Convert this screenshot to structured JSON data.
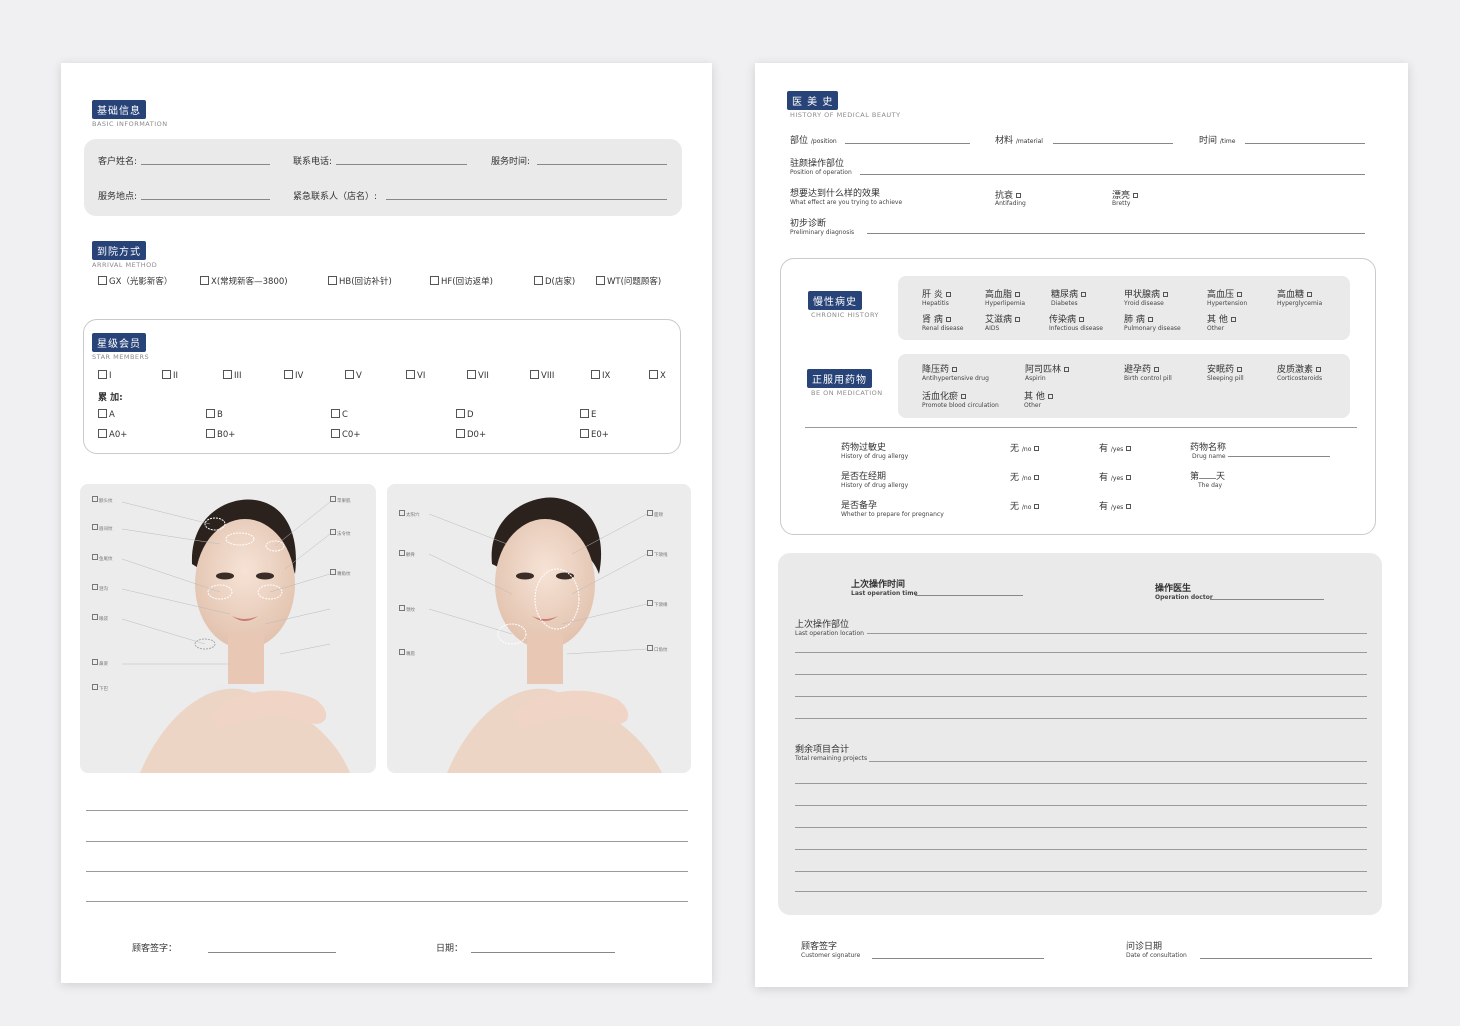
{
  "left": {
    "basic": {
      "title": "基础信息",
      "en": "BASIC INFORMATION",
      "customer_name": "客户姓名:",
      "phone": "联系电话:",
      "service_time": "服务时间:",
      "service_place": "服务地点:",
      "emergency": "紧急联系人（店名）:"
    },
    "arrival": {
      "title": "到院方式",
      "en": "ARRIVAL METHOD",
      "options": [
        "GX（光影新客）",
        "X(常规新客—3800)",
        "HB(回访补针)",
        "HF(回访返单)",
        "D(店家)",
        "WT(问题顾客)"
      ]
    },
    "star": {
      "title": "星级会员",
      "en": "STAR MEMBERS",
      "levels": [
        "I",
        "II",
        "III",
        "IV",
        "V",
        "VI",
        "VII",
        "VIII",
        "IX",
        "X"
      ],
      "accumulate_label": "累 加:",
      "grades_a": [
        "A",
        "B",
        "C",
        "D",
        "E"
      ],
      "grades_b": [
        "A0+",
        "B0+",
        "C0+",
        "D0+",
        "E0+"
      ]
    },
    "face_left_labels": [
      "额头纹",
      "眉间纹",
      "鱼尾纹",
      "泪沟",
      "眼袋",
      "鼻梁",
      "苹果肌",
      "法令纹",
      "嘴角纹",
      "下巴"
    ],
    "face_right_labels": [
      "太阳穴",
      "颧骨",
      "面颊",
      "下颌线",
      "颈纹",
      "嘴唇",
      "下颌缘",
      "口角纹"
    ],
    "signature": {
      "customer": "顾客签字：",
      "date": "日期："
    }
  },
  "right": {
    "history": {
      "title": "医 美 史",
      "en": "HISTORY OF MEDICAL BEAUTY",
      "position": "部位",
      "position_en": "/position",
      "material": "材料",
      "material_en": "/material",
      "time": "时间",
      "time_en": "/time",
      "op_position": "驻颜操作部位",
      "op_position_en": "Position of operation",
      "effect": "想要达到什么样的效果",
      "effect_en": "What effect are you trying to achieve",
      "antiaging": "抗衰",
      "antiaging_en": "Antifading",
      "pretty": "漂亮",
      "pretty_en": "Bretty",
      "diagnosis": "初步诊断",
      "diagnosis_en": "Preliminary diagnosis"
    },
    "chronic": {
      "title": "慢性病史",
      "en": "CHRONIC HISTORY",
      "items": [
        {
          "cn": "肝 炎",
          "en": "Hepatitis"
        },
        {
          "cn": "高血脂",
          "en": "Hyperlipemia"
        },
        {
          "cn": "糖尿病",
          "en": "Diabetes"
        },
        {
          "cn": "甲状腺病",
          "en": "Yroid disease"
        },
        {
          "cn": "高血压",
          "en": "Hypertension"
        },
        {
          "cn": "高血糖",
          "en": "Hyperglycemia"
        },
        {
          "cn": "肾 病",
          "en": "Renal disease"
        },
        {
          "cn": "艾滋病",
          "en": "AIDS"
        },
        {
          "cn": "传染病",
          "en": "Infectious disease"
        },
        {
          "cn": "肺 病",
          "en": "Pulmonary disease"
        },
        {
          "cn": "其 他",
          "en": "Other"
        }
      ]
    },
    "medication": {
      "title": "正服用药物",
      "en": "BE ON MEDICATION",
      "items": [
        {
          "cn": "降压药",
          "en": "Antihypertensive drug"
        },
        {
          "cn": "阿司匹林",
          "en": "Aspirin"
        },
        {
          "cn": "避孕药",
          "en": "Birth control pill"
        },
        {
          "cn": "安眠药",
          "en": "Sleeping pill"
        },
        {
          "cn": "皮质激素",
          "en": "Corticosteroids"
        },
        {
          "cn": "活血化瘀",
          "en": "Promote blood circulation"
        },
        {
          "cn": "其 他",
          "en": "Other"
        }
      ]
    },
    "allergy": {
      "rows": [
        {
          "cn": "药物过敏史",
          "en": "History of drug allergy"
        },
        {
          "cn": "是否在经期",
          "en": "History of drug allergy"
        },
        {
          "cn": "是否备孕",
          "en": "Whether to prepare for pregnancy"
        }
      ],
      "no": "无",
      "no_en": "/no",
      "yes": "有",
      "yes_en": "/yes",
      "drug_name": "药物名称",
      "drug_name_en": "Drug name",
      "day_prefix": "第",
      "day_suffix": "天",
      "day_en": "The day"
    },
    "last": {
      "time": "上次操作时间",
      "time_en": "Last operation time",
      "doctor": "操作医生",
      "doctor_en": "Operation doctor",
      "location": "上次操作部位",
      "location_en": "Last operation location",
      "remaining": "剩余项目合计",
      "remaining_en": "Total remaining projects"
    },
    "signature": {
      "customer": "顾客签字",
      "customer_en": "Customer signature",
      "date": "问诊日期",
      "date_en": "Date of consultation"
    }
  },
  "colors": {
    "accent": "#274378",
    "panel": "#eaeaea"
  }
}
